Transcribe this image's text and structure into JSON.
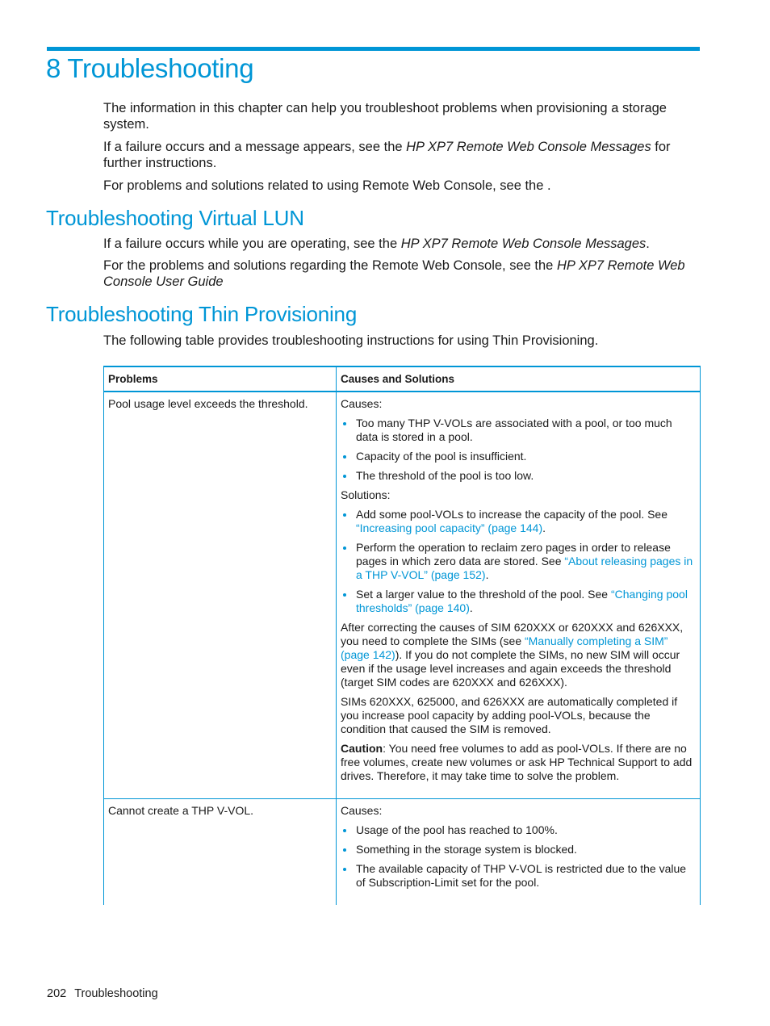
{
  "chapter": {
    "title": "8 Troubleshooting",
    "intro": [
      {
        "text": "The information in this chapter can help you troubleshoot problems when provisioning a storage system."
      },
      {
        "before": "If a failure occurs and a message appears, see the ",
        "italic": "HP XP7 Remote Web Console Messages",
        "after": " for further instructions."
      },
      {
        "text": "For problems and solutions related to using Remote Web Console, see the ."
      }
    ]
  },
  "sections": [
    {
      "heading": "Troubleshooting Virtual LUN",
      "paragraphs": [
        {
          "before": "If a failure occurs while you are operating, see the ",
          "italic": "HP XP7 Remote Web Console Messages",
          "after": "."
        },
        {
          "before": "For the problems and solutions regarding the Remote Web Console, see the ",
          "italic": "HP XP7 Remote Web Console User Guide",
          "after": ""
        }
      ]
    },
    {
      "heading": "Troubleshooting Thin Provisioning",
      "paragraphs": [
        {
          "text": "The following table provides troubleshooting instructions for using Thin Provisioning."
        }
      ]
    }
  ],
  "table": {
    "headers": [
      "Problems",
      "Causes and Solutions"
    ],
    "rows": [
      {
        "problem": "Pool usage level exceeds the threshold.",
        "causes_label": "Causes:",
        "causes": [
          "Too many THP V-VOLs are associated with a pool, or too much data is stored in a pool.",
          "Capacity of the pool is insufficient.",
          "The threshold of the pool is too low."
        ],
        "solutions_label": "Solutions:",
        "solutions": [
          {
            "before": "Add some pool-VOLs to increase the capacity of the pool. See ",
            "link": "“Increasing pool capacity” (page 144)",
            "after": "."
          },
          {
            "before": "Perform the operation to reclaim zero pages in order to release pages in which zero data are stored. See ",
            "link": "“About releasing pages in a THP V-VOL” (page 152)",
            "after": "."
          },
          {
            "before": "Set a larger value to the threshold of the pool. See ",
            "link": "“Changing pool thresholds” (page 140)",
            "after": "."
          }
        ],
        "notes": [
          {
            "before": "After correcting the causes of SIM 620XXX or 620XXX and 626XXX, you need to complete the SIMs (see ",
            "link": "“Manually completing a SIM” (page 142)",
            "after": "). If you do not complete the SIMs, no new SIM will occur even if the usage level increases and again exceeds the threshold (target SIM codes are 620XXX and 626XXX)."
          },
          {
            "before": "SIMs 620XXX, 625000, and 626XXX are automatically completed if you increase pool capacity by adding pool-VOLs, because the condition that caused the SIM is removed.",
            "link": "",
            "after": ""
          }
        ],
        "caution_label": "Caution",
        "caution_text": ": You need free volumes to add as pool-VOLs. If there are no free volumes, create new volumes or ask HP Technical Support to add drives. Therefore, it may take time to solve the problem."
      },
      {
        "problem": "Cannot create a THP V-VOL.",
        "causes_label": "Causes:",
        "causes": [
          "Usage of the pool has reached to 100%.",
          "Something in the storage system is blocked.",
          "The available capacity of THP V-VOL is restricted due to the value of Subscription-Limit set for the pool."
        ]
      }
    ]
  },
  "footer": {
    "page_number": "202",
    "section": "Troubleshooting"
  },
  "colors": {
    "accent": "#0096d6",
    "text": "#1a1a1a"
  }
}
